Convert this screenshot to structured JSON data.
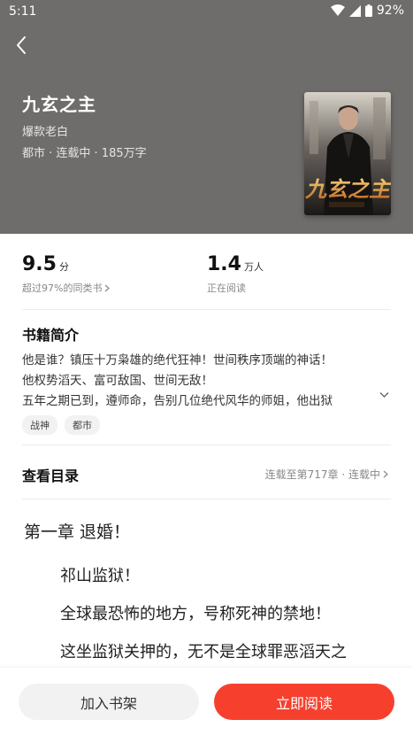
{
  "status_bar": {
    "time": "5:11",
    "battery": "92%"
  },
  "book": {
    "title": "九玄之主",
    "author": "爆款老白",
    "meta": "都市 · 连载中 · 185万字",
    "cover_text": "九玄之主"
  },
  "stats": {
    "score": {
      "value": "9.5",
      "unit": "分",
      "sub": "超过97%的同类书"
    },
    "readers": {
      "value": "1.4",
      "unit": "万人",
      "sub": "正在阅读"
    }
  },
  "intro": {
    "heading": "书籍简介",
    "lines": [
      "他是谁？镇压十万枭雄的绝代狂神！世间秩序顶端的神话！",
      "他权势滔天、富可敌国、世间无敌！",
      "五年之期已到，遵师命，告别几位绝代风华的师姐，他出狱"
    ]
  },
  "tags": [
    "战神",
    "都市"
  ],
  "toc": {
    "title": "查看目录",
    "status": "连载至第717章 · 连载中"
  },
  "chapter": {
    "title": "第一章 退婚！",
    "paragraphs": [
      "祁山监狱！",
      "全球最恐怖的地方，号称死神的禁地！",
      "这坐监狱关押的，无不是全球罪恶滔天之"
    ]
  },
  "actions": {
    "add_shelf": "加入书架",
    "read_now": "立即阅读"
  },
  "colors": {
    "accent": "#f6402d",
    "hero_bg": "#6e6d6b"
  },
  "icons": {
    "back": "chevron-left-icon",
    "wifi": "wifi-icon",
    "signal": "cell-signal-icon",
    "battery": "battery-icon",
    "chevron": "chevron-right-icon",
    "expand": "chevron-down-icon"
  }
}
